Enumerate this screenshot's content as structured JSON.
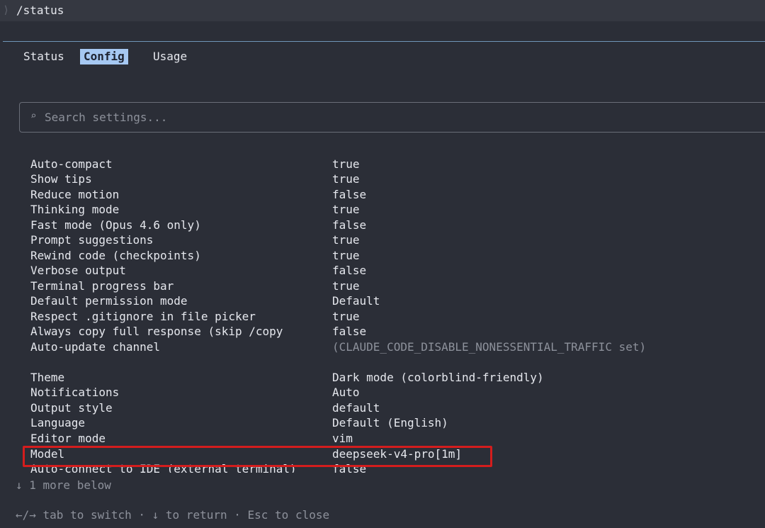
{
  "command_bar": {
    "prompt_glyph": "⟩",
    "command": "/status"
  },
  "tabs": [
    {
      "label": "Status",
      "active": false
    },
    {
      "label": "Config",
      "active": true
    },
    {
      "label": "Usage",
      "active": false
    }
  ],
  "search": {
    "icon": "search-icon",
    "icon_glyph": "⌕",
    "placeholder": "Search settings..."
  },
  "settings": [
    {
      "label": "Auto-compact",
      "value": "true"
    },
    {
      "label": "Show tips",
      "value": "true"
    },
    {
      "label": "Reduce motion",
      "value": "false"
    },
    {
      "label": "Thinking mode",
      "value": "true"
    },
    {
      "label": "Fast mode (Opus 4.6 only)",
      "value": "false"
    },
    {
      "label": "Prompt suggestions",
      "value": "true"
    },
    {
      "label": "Rewind code (checkpoints)",
      "value": "true"
    },
    {
      "label": "Verbose output",
      "value": "false"
    },
    {
      "label": "Terminal progress bar",
      "value": "true"
    },
    {
      "label": "Default permission mode",
      "value": "Default"
    },
    {
      "label": "Respect .gitignore in file picker",
      "value": "true"
    },
    {
      "label": "Always copy full response (skip /copy",
      "value": "false"
    },
    {
      "label": "Auto-update channel",
      "value": "(CLAUDE_CODE_DISABLE_NONESSENTIAL_TRAFFIC set)"
    },
    {
      "label": "Theme",
      "value": "Dark mode (colorblind-friendly)"
    },
    {
      "label": "Notifications",
      "value": "Auto"
    },
    {
      "label": "Output style",
      "value": "default"
    },
    {
      "label": "Language",
      "value": "Default (English)"
    },
    {
      "label": "Editor mode",
      "value": "vim"
    },
    {
      "label": "Model",
      "value": "deepseek-v4-pro[1m]"
    },
    {
      "label": "Auto-connect to IDE (external terminal)",
      "value": "false"
    }
  ],
  "more_below": "↓ 1 more below",
  "footer": "←/→ tab to switch · ↓ to return · Esc to close",
  "colors": {
    "background": "#2b2e37",
    "active_tab": "#a6c8f2",
    "highlight_annotation": "#d41d1d"
  }
}
